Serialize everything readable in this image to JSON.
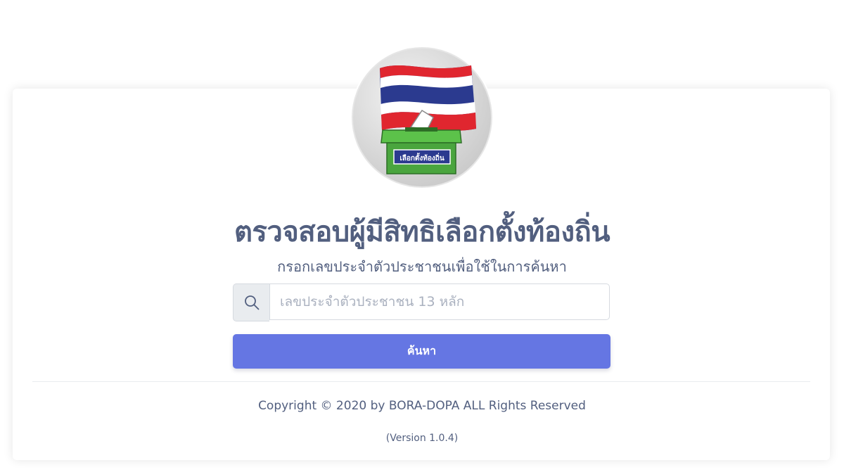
{
  "logo": {
    "ballot_box_label": "เลือกตั้งท้องถิ่น",
    "icon": "thai-flag-ballot-box-logo"
  },
  "header": {
    "title": "ตรวจสอบผู้มีสิทธิเลือกตั้งท้องถิ่น",
    "subtitle": "กรอกเลขประจำตัวประชาชนเพื่อใช้ในการค้นหา"
  },
  "search": {
    "icon": "search-icon",
    "placeholder": "เลขประจำตัวประชาชน 13 หลัก",
    "value": "",
    "button_label": "ค้นหา"
  },
  "footer": {
    "copyright": "Copyright © 2020 by BORA-DOPA ALL Rights Reserved",
    "version": "(Version 1.0.4)"
  },
  "colors": {
    "primary": "#6576e3",
    "text": "#525f7f",
    "flag_red": "#e0262f",
    "flag_blue": "#2b3a8f",
    "box_green": "#4caf50"
  }
}
